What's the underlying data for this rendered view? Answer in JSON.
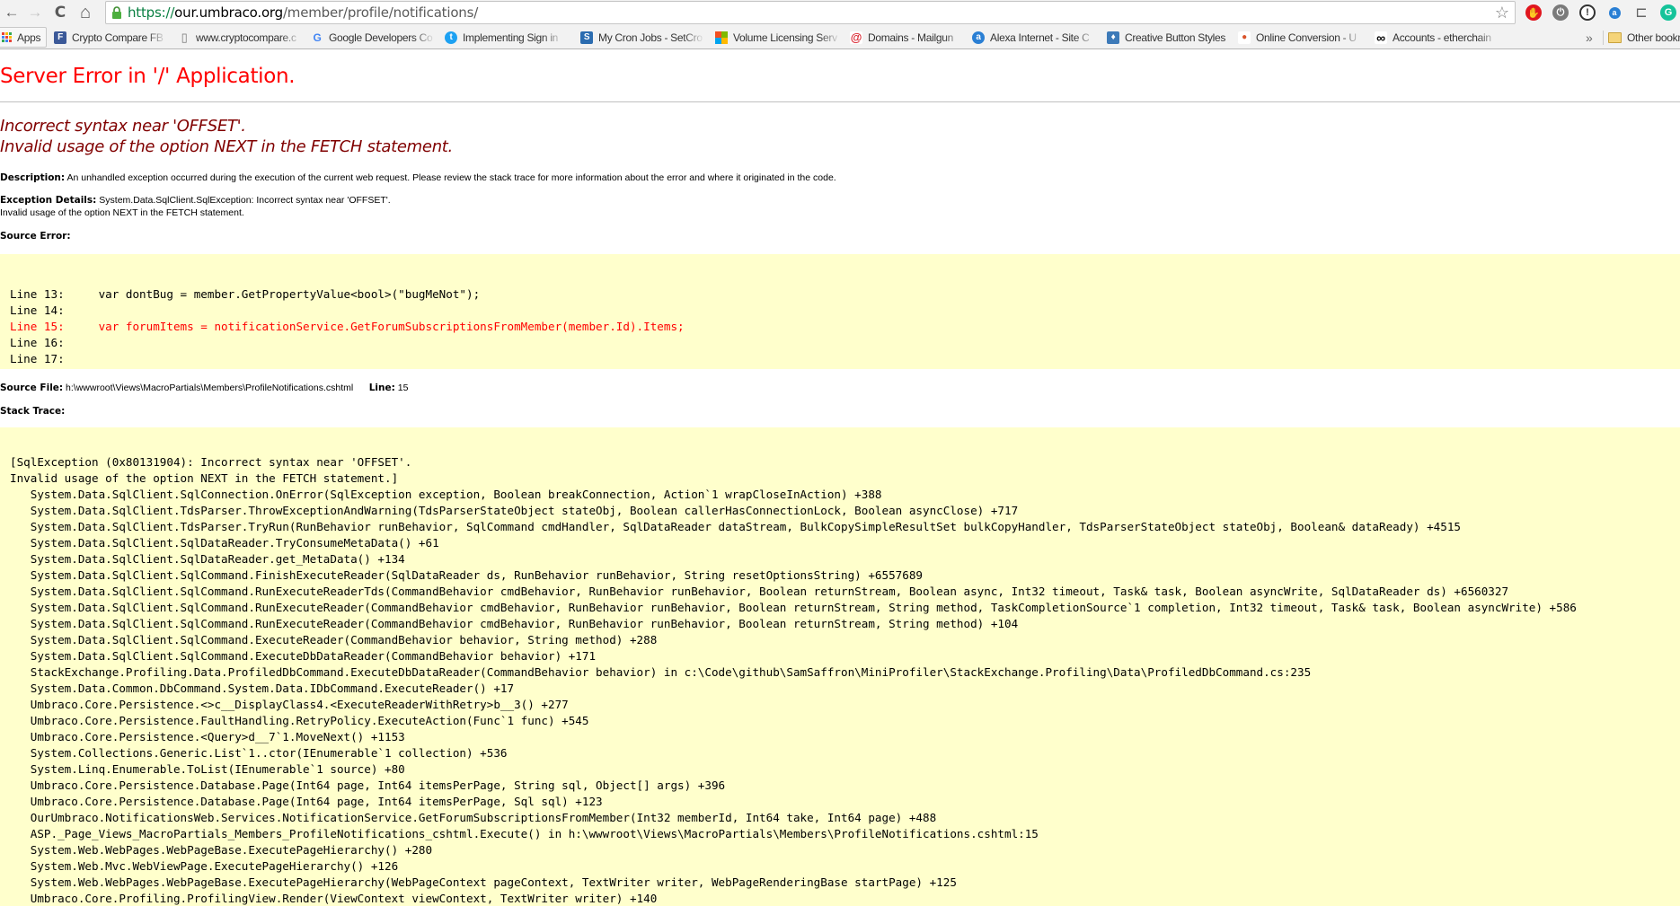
{
  "browser": {
    "url_scheme": "https://",
    "url_host": "our.umbraco.org",
    "url_path": "/member/profile/notifications/",
    "nav": {
      "back": "←",
      "forward": "→",
      "reload": "C",
      "home": "⌂"
    },
    "star": "☆",
    "extensions": [
      {
        "name": "adblock-extension-icon",
        "glyph": "✋",
        "color": "#e0161e"
      },
      {
        "name": "power-extension-icon",
        "glyph": "⏻",
        "color": "#7a7a7a"
      },
      {
        "name": "password-manager-extension-icon",
        "glyph": "!",
        "color": "#333333"
      },
      {
        "name": "alexa-extension-icon",
        "glyph": "a",
        "color": "#2a7fd4"
      },
      {
        "name": "cast-icon",
        "glyph": "⊏",
        "color": "#666666"
      },
      {
        "name": "grammarly-extension-icon",
        "glyph": "G",
        "color": "#15c39a"
      }
    ]
  },
  "bookmarks": {
    "apps_label": "Apps",
    "items": [
      {
        "label": "Crypto Compare FB",
        "icon": "F",
        "icon_color": "#3b5998"
      },
      {
        "label": "www.cryptocompare.c",
        "icon": "▯",
        "icon_color": "#ffffff"
      },
      {
        "label": "Google Developers Co",
        "icon": "G",
        "icon_color": "#ffffff"
      },
      {
        "label": "Implementing Sign in",
        "icon": "t",
        "icon_color": "#1da1f2"
      },
      {
        "label": "My Cron Jobs - SetCro",
        "icon": "S",
        "icon_color": "#2b6cb0"
      },
      {
        "label": "Volume Licensing Serv",
        "icon": "■",
        "icon_color": "#ffffff"
      },
      {
        "label": "Domains - Mailgun",
        "icon": "@",
        "icon_color": "#d9232e"
      },
      {
        "label": "Alexa Internet - Site C",
        "icon": "a",
        "icon_color": "#2a7fd4"
      },
      {
        "label": "Creative Button Styles",
        "icon": "♦",
        "icon_color": "#3d7ab8"
      },
      {
        "label": "Online Conversion - U",
        "icon": "●",
        "icon_color": "#d9542b"
      },
      {
        "label": "Accounts - etherchain",
        "icon": "∞",
        "icon_color": "#000000"
      }
    ],
    "overflow": "»",
    "other_label": "Other bookmarks"
  },
  "error": {
    "title": "Server Error in '/' Application.",
    "message_line1": "Incorrect syntax near 'OFFSET'.",
    "message_line2": "Invalid usage of the option NEXT in the FETCH statement.",
    "description_label": "Description:",
    "description_text": "An unhandled exception occurred during the execution of the current web request. Please review the stack trace for more information about the error and where it originated in the code.",
    "exception_label": "Exception Details:",
    "exception_text": "System.Data.SqlClient.SqlException: Incorrect syntax near 'OFFSET'.",
    "exception_text2": "Invalid usage of the option NEXT in the FETCH statement.",
    "source_error_label": "Source Error:",
    "source_lines": [
      {
        "text": "Line 13:     var dontBug = member.GetPropertyValue<bool>(\"bugMeNot\");",
        "highlight": false
      },
      {
        "text": "Line 14:",
        "highlight": false
      },
      {
        "text": "Line 15:     var forumItems = notificationService.GetForumSubscriptionsFromMember(member.Id).Items;",
        "highlight": true
      },
      {
        "text": "Line 16:",
        "highlight": false
      },
      {
        "text": "Line 17:",
        "highlight": false
      }
    ],
    "source_file_label": "Source File:",
    "source_file": "h:\\wwwroot\\Views\\MacroPartials\\Members\\ProfileNotifications.cshtml",
    "line_label": "Line:",
    "line_number": "15",
    "stack_trace_label": "Stack Trace:",
    "stack_trace": [
      "[SqlException (0x80131904): Incorrect syntax near 'OFFSET'.",
      "Invalid usage of the option NEXT in the FETCH statement.]",
      "   System.Data.SqlClient.SqlConnection.OnError(SqlException exception, Boolean breakConnection, Action`1 wrapCloseInAction) +388",
      "   System.Data.SqlClient.TdsParser.ThrowExceptionAndWarning(TdsParserStateObject stateObj, Boolean callerHasConnectionLock, Boolean asyncClose) +717",
      "   System.Data.SqlClient.TdsParser.TryRun(RunBehavior runBehavior, SqlCommand cmdHandler, SqlDataReader dataStream, BulkCopySimpleResultSet bulkCopyHandler, TdsParserStateObject stateObj, Boolean& dataReady) +4515",
      "   System.Data.SqlClient.SqlDataReader.TryConsumeMetaData() +61",
      "   System.Data.SqlClient.SqlDataReader.get_MetaData() +134",
      "   System.Data.SqlClient.SqlCommand.FinishExecuteReader(SqlDataReader ds, RunBehavior runBehavior, String resetOptionsString) +6557689",
      "   System.Data.SqlClient.SqlCommand.RunExecuteReaderTds(CommandBehavior cmdBehavior, RunBehavior runBehavior, Boolean returnStream, Boolean async, Int32 timeout, Task& task, Boolean asyncWrite, SqlDataReader ds) +6560327",
      "   System.Data.SqlClient.SqlCommand.RunExecuteReader(CommandBehavior cmdBehavior, RunBehavior runBehavior, Boolean returnStream, String method, TaskCompletionSource`1 completion, Int32 timeout, Task& task, Boolean asyncWrite) +586",
      "   System.Data.SqlClient.SqlCommand.RunExecuteReader(CommandBehavior cmdBehavior, RunBehavior runBehavior, Boolean returnStream, String method) +104",
      "   System.Data.SqlClient.SqlCommand.ExecuteReader(CommandBehavior behavior, String method) +288",
      "   System.Data.SqlClient.SqlCommand.ExecuteDbDataReader(CommandBehavior behavior) +171",
      "   StackExchange.Profiling.Data.ProfiledDbCommand.ExecuteDbDataReader(CommandBehavior behavior) in c:\\Code\\github\\SamSaffron\\MiniProfiler\\StackExchange.Profiling\\Data\\ProfiledDbCommand.cs:235",
      "   System.Data.Common.DbCommand.System.Data.IDbCommand.ExecuteReader() +17",
      "   Umbraco.Core.Persistence.<>c__DisplayClass4.<ExecuteReaderWithRetry>b__3() +277",
      "   Umbraco.Core.Persistence.FaultHandling.RetryPolicy.ExecuteAction(Func`1 func) +545",
      "   Umbraco.Core.Persistence.<Query>d__7`1.MoveNext() +1153",
      "   System.Collections.Generic.List`1..ctor(IEnumerable`1 collection) +536",
      "   System.Linq.Enumerable.ToList(IEnumerable`1 source) +80",
      "   Umbraco.Core.Persistence.Database.Page(Int64 page, Int64 itemsPerPage, String sql, Object[] args) +396",
      "   Umbraco.Core.Persistence.Database.Page(Int64 page, Int64 itemsPerPage, Sql sql) +123",
      "   OurUmbraco.NotificationsWeb.Services.NotificationService.GetForumSubscriptionsFromMember(Int32 memberId, Int64 take, Int64 page) +488",
      "   ASP._Page_Views_MacroPartials_Members_ProfileNotifications_cshtml.Execute() in h:\\wwwroot\\Views\\MacroPartials\\Members\\ProfileNotifications.cshtml:15",
      "   System.Web.WebPages.WebPageBase.ExecutePageHierarchy() +280",
      "   System.Web.Mvc.WebViewPage.ExecutePageHierarchy() +126",
      "   System.Web.WebPages.WebPageBase.ExecutePageHierarchy(WebPageContext pageContext, TextWriter writer, WebPageRenderingBase startPage) +125",
      "   Umbraco.Core.Profiling.ProfilingView.Render(ViewContext viewContext, TextWriter writer) +140"
    ]
  }
}
